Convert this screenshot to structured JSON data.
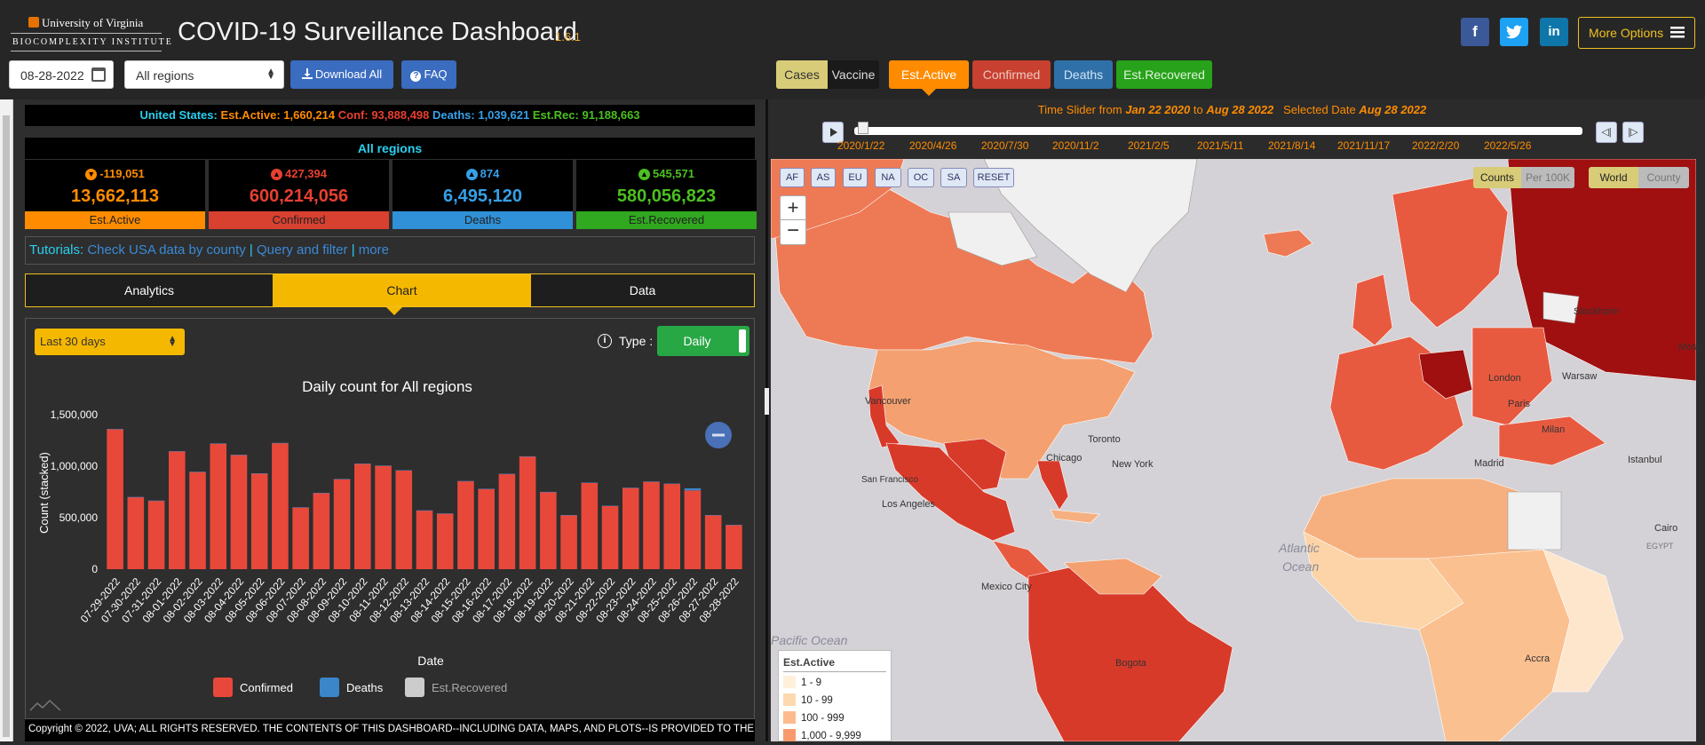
{
  "header": {
    "logo": {
      "line1": "University of Virginia",
      "line2": "BIOCOMPLEXITY INSTITUTE"
    },
    "title": "COVID-19 Surveillance Dashboard",
    "version": "1.6.1",
    "social": {
      "facebook": "f",
      "twitter": "t",
      "linkedin": "in"
    },
    "more_options": "More Options"
  },
  "toolbar": {
    "date": "08-28-2022",
    "region": "All regions",
    "download_label": "Download All",
    "faq_label": "FAQ"
  },
  "map_tabs": {
    "cases": "Cases",
    "vaccine": "Vaccine",
    "metrics": [
      "Est.Active",
      "Confirmed",
      "Deaths",
      "Est.Recovered"
    ],
    "active_metric": "Est.Active"
  },
  "us_summary": {
    "label": "United States:",
    "active_label": "Est.Active:",
    "active": "1,660,214",
    "conf_label": "Conf:",
    "conf": "93,888,498",
    "deaths_label": "Deaths:",
    "deaths": "1,039,621",
    "rec_label": "Est.Rec:",
    "rec": "91,188,663"
  },
  "region_header": "All regions",
  "stats": {
    "est_active": {
      "delta": "-119,051",
      "total": "13,662,113",
      "label": "Est.Active"
    },
    "confirmed": {
      "delta": "427,394",
      "total": "600,214,056",
      "label": "Confirmed"
    },
    "deaths": {
      "delta": "874",
      "total": "6,495,120",
      "label": "Deaths"
    },
    "est_recovered": {
      "delta": "545,571",
      "total": "580,056,823",
      "label": "Est.Recovered"
    }
  },
  "tutorials": {
    "label": "Tutorials:",
    "link1": "Check USA data by county",
    "link2": "Query and filter",
    "link3": "more"
  },
  "view_tabs": [
    "Analytics",
    "Chart",
    "Data"
  ],
  "chart_controls": {
    "range": "Last 30 days",
    "type_label": "Type :",
    "type_value": "Daily"
  },
  "chart_data": {
    "type": "bar",
    "title": "Daily count for All regions",
    "xlabel": "Date",
    "ylabel": "Count (stacked)",
    "ylim": [
      0,
      1500000
    ],
    "yticks": [
      "0",
      "500,000",
      "1,000,000",
      "1,500,000"
    ],
    "categories": [
      "07-29-2022",
      "07-30-2022",
      "07-31-2022",
      "08-01-2022",
      "08-02-2022",
      "08-03-2022",
      "08-04-2022",
      "08-05-2022",
      "08-06-2022",
      "08-07-2022",
      "08-08-2022",
      "08-09-2022",
      "08-10-2022",
      "08-11-2022",
      "08-12-2022",
      "08-13-2022",
      "08-14-2022",
      "08-15-2022",
      "08-16-2022",
      "08-17-2022",
      "08-18-2022",
      "08-19-2022",
      "08-20-2022",
      "08-21-2022",
      "08-22-2022",
      "08-23-2022",
      "08-24-2022",
      "08-25-2022",
      "08-26-2022",
      "08-27-2022",
      "08-28-2022"
    ],
    "series": [
      {
        "name": "Confirmed",
        "color": "#e8483a",
        "values": [
          1360000,
          700000,
          665000,
          1145000,
          945000,
          1220000,
          1110000,
          930000,
          1225000,
          600000,
          740000,
          875000,
          1025000,
          1005000,
          960000,
          570000,
          540000,
          855000,
          780000,
          925000,
          1095000,
          750000,
          525000,
          840000,
          615000,
          790000,
          850000,
          830000,
          765000,
          525000,
          430000
        ]
      },
      {
        "name": "Deaths",
        "color": "#3a86c8",
        "values": [
          1000,
          1000,
          1000,
          1000,
          1000,
          1000,
          1000,
          1000,
          1000,
          1000,
          1000,
          1000,
          1000,
          1000,
          1000,
          1000,
          1000,
          1000,
          1000,
          1000,
          1000,
          1000,
          1000,
          1000,
          1000,
          1000,
          1000,
          1000,
          20000,
          1000,
          1000
        ]
      },
      {
        "name": "Est.Recovered",
        "color": "#cccccc",
        "values": [
          0,
          0,
          0,
          0,
          0,
          0,
          0,
          0,
          0,
          0,
          0,
          0,
          0,
          0,
          0,
          0,
          0,
          0,
          0,
          0,
          0,
          0,
          0,
          0,
          0,
          0,
          0,
          0,
          0,
          0,
          0
        ]
      }
    ],
    "legend_position": "bottom",
    "grid": false
  },
  "footer": "Copyright © 2022, UVA; ALL RIGHTS RESERVED. THE CONTENTS OF THIS DASHBOARD--INCLUDING DATA, MAPS, AND PLOTS--IS PROVIDED TO THE",
  "time_slider": {
    "prefix": "Time Slider from",
    "from": "Jan 22 2020",
    "to_word": "to",
    "to": "Aug 28 2022",
    "selected_label": "Selected Date",
    "selected": "Aug 28 2022",
    "ticks": [
      "2020/1/22",
      "2020/4/26",
      "2020/7/30",
      "2020/11/2",
      "2021/2/5",
      "2021/5/11",
      "2021/8/14",
      "2021/11/17",
      "2022/2/20",
      "2022/5/26"
    ]
  },
  "map": {
    "region_buttons": [
      "AF",
      "AS",
      "EU",
      "NA",
      "OC",
      "SA",
      "RESET"
    ],
    "toggles": {
      "counts": "Counts",
      "per100k": "Per 100K",
      "world": "World",
      "county": "County"
    },
    "cities": [
      "Vancouver",
      "San Francisco",
      "Los Angeles",
      "Chicago",
      "Toronto",
      "New York",
      "Mexico City",
      "Bogota",
      "London",
      "Paris",
      "Milan",
      "Madrid",
      "Warsaw",
      "Stockholm",
      "Istanbul",
      "Cairo",
      "EGYPT",
      "Accra",
      "Mosc"
    ],
    "oceans": [
      "Atlantic",
      "Ocean",
      "Pacific Ocean"
    ],
    "legend": {
      "title": "Est.Active",
      "bins": [
        {
          "label": "1 - 9",
          "color": "#fff0dc"
        },
        {
          "label": "10 - 99",
          "color": "#fdd9b0"
        },
        {
          "label": "100 - 999",
          "color": "#fcbb8c"
        },
        {
          "label": "1,000 - 9,999",
          "color": "#f89a6c"
        }
      ]
    }
  }
}
